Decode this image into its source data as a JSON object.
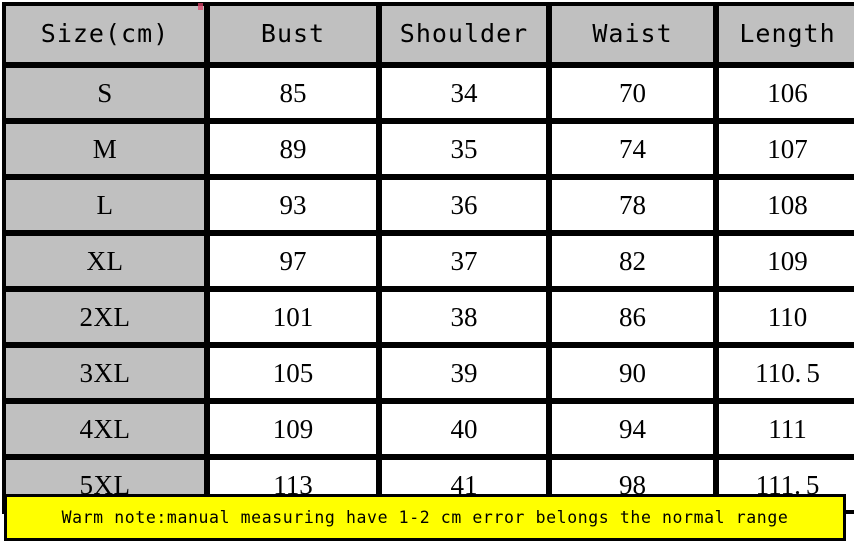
{
  "table": {
    "columns": [
      {
        "key": "size",
        "label": "Size(cm)"
      },
      {
        "key": "bust",
        "label": "Bust"
      },
      {
        "key": "shoulder",
        "label": "Shoulder"
      },
      {
        "key": "waist",
        "label": "Waist"
      },
      {
        "key": "length",
        "label": "Length"
      }
    ],
    "rows": [
      {
        "size": "S",
        "bust": "85",
        "shoulder": "34",
        "waist": "70",
        "length": "106"
      },
      {
        "size": "M",
        "bust": "89",
        "shoulder": "35",
        "waist": "74",
        "length": "107"
      },
      {
        "size": "L",
        "bust": "93",
        "shoulder": "36",
        "waist": "78",
        "length": "108"
      },
      {
        "size": "XL",
        "bust": "97",
        "shoulder": "37",
        "waist": "82",
        "length": "109"
      },
      {
        "size": "2XL",
        "bust": "101",
        "shoulder": "38",
        "waist": "86",
        "length": "110"
      },
      {
        "size": "3XL",
        "bust": "105",
        "shoulder": "39",
        "waist": "90",
        "length": "110.5"
      },
      {
        "size": "4XL",
        "bust": "109",
        "shoulder": "40",
        "waist": "94",
        "length": "111"
      },
      {
        "size": "5XL",
        "bust": "113",
        "shoulder": "41",
        "waist": "98",
        "length": "111.5"
      }
    ]
  },
  "banner": {
    "text": "Warm note:manual measuring have 1-2 cm error belongs the normal range",
    "background_color": "#ffff00",
    "text_color": "#000000"
  },
  "colors": {
    "header_fill": "#c0c0c0",
    "cell_fill": "#ffffff",
    "border": "#000000",
    "page_background": "#ffffff"
  }
}
